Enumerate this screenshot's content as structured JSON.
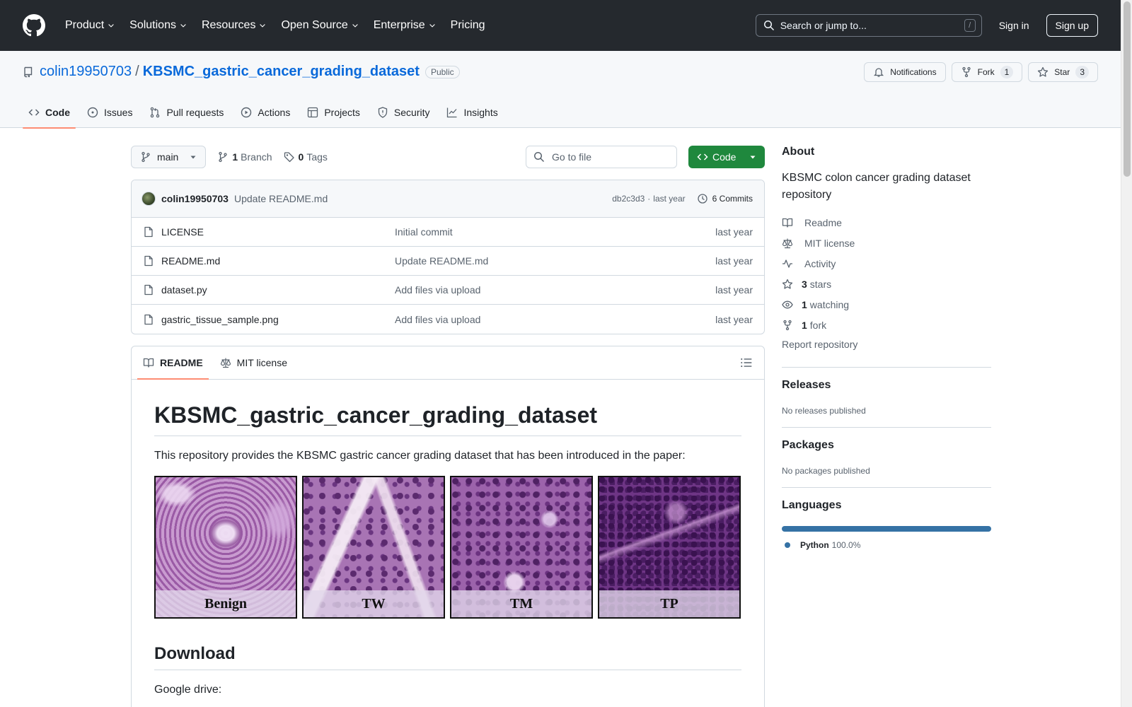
{
  "header": {
    "nav": [
      {
        "label": "Product",
        "dropdown": true
      },
      {
        "label": "Solutions",
        "dropdown": true
      },
      {
        "label": "Resources",
        "dropdown": true
      },
      {
        "label": "Open Source",
        "dropdown": true
      },
      {
        "label": "Enterprise",
        "dropdown": true
      },
      {
        "label": "Pricing",
        "dropdown": false
      }
    ],
    "search_placeholder": "Search or jump to...",
    "search_shortcut": "/",
    "sign_in": "Sign in",
    "sign_up": "Sign up"
  },
  "repo": {
    "owner": "colin19950703",
    "separator": "/",
    "name": "KBSMC_gastric_cancer_grading_dataset",
    "visibility": "Public",
    "actions": {
      "notifications": "Notifications",
      "fork": "Fork",
      "fork_count": "1",
      "star": "Star",
      "star_count": "3"
    },
    "tabs": [
      {
        "label": "Code",
        "icon": "code-icon",
        "active": true
      },
      {
        "label": "Issues",
        "icon": "issue-icon",
        "active": false
      },
      {
        "label": "Pull requests",
        "icon": "pull-request-icon",
        "active": false
      },
      {
        "label": "Actions",
        "icon": "play-icon",
        "active": false
      },
      {
        "label": "Projects",
        "icon": "table-icon",
        "active": false
      },
      {
        "label": "Security",
        "icon": "shield-icon",
        "active": false
      },
      {
        "label": "Insights",
        "icon": "graph-icon",
        "active": false
      }
    ]
  },
  "toolbar": {
    "branch": "main",
    "branch_count": "1",
    "branch_label": "Branch",
    "tag_count": "0",
    "tag_label": "Tags",
    "goto_placeholder": "Go to file",
    "code_button": "Code"
  },
  "latest_commit": {
    "author": "colin19950703",
    "message": "Update README.md",
    "hash": "db2c3d3",
    "separator": "·",
    "time": "last year",
    "commits_label": "6 Commits"
  },
  "files": [
    {
      "name": "LICENSE",
      "message": "Initial commit",
      "date": "last year"
    },
    {
      "name": "README.md",
      "message": "Update README.md",
      "date": "last year"
    },
    {
      "name": "dataset.py",
      "message": "Add files via upload",
      "date": "last year"
    },
    {
      "name": "gastric_tissue_sample.png",
      "message": "Add files via upload",
      "date": "last year"
    }
  ],
  "readme": {
    "tabs": [
      {
        "label": "README",
        "icon": "book-icon",
        "active": true
      },
      {
        "label": "MIT license",
        "icon": "law-icon",
        "active": false
      }
    ],
    "title": "KBSMC_gastric_cancer_grading_dataset",
    "intro": "This repository provides the KBSMC gastric cancer grading dataset that has been introduced in the paper:",
    "samples": [
      "Benign",
      "TW",
      "TM",
      "TP"
    ],
    "download_heading": "Download",
    "download_text": "Google drive:"
  },
  "sidebar": {
    "about_title": "About",
    "description": "KBSMC colon cancer grading dataset repository",
    "items": [
      {
        "icon": "book-icon",
        "count": "",
        "label": "Readme"
      },
      {
        "icon": "law-icon",
        "count": "",
        "label": "MIT license"
      },
      {
        "icon": "pulse-icon",
        "count": "",
        "label": "Activity"
      },
      {
        "icon": "star-icon",
        "count": "3",
        "label": "stars"
      },
      {
        "icon": "eye-icon",
        "count": "1",
        "label": "watching"
      },
      {
        "icon": "fork-icon",
        "count": "1",
        "label": "fork"
      }
    ],
    "report": "Report repository",
    "releases_title": "Releases",
    "releases_text": "No releases published",
    "packages_title": "Packages",
    "packages_text": "No packages published",
    "languages_title": "Languages",
    "languages": [
      {
        "name": "Python",
        "percent": "100.0%",
        "color": "#3572A5"
      }
    ]
  },
  "colors": {
    "header_bg": "#25292e",
    "link": "#0969da",
    "code_button": "#1f883d",
    "active_tab_underline": "#fd8c73"
  }
}
